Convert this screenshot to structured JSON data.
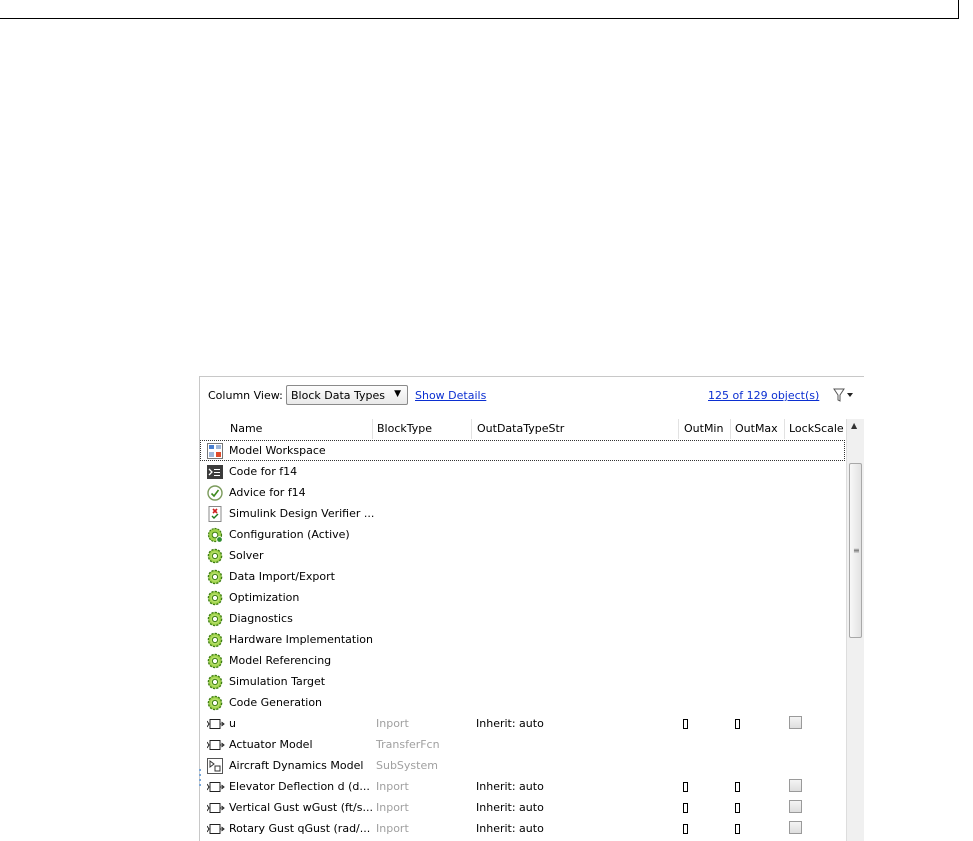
{
  "toolbar": {
    "column_view_label": "Column View:",
    "column_view_value": "Block Data Types",
    "show_details_label": "Show Details",
    "object_count": "125 of 129 object(s)"
  },
  "columns": {
    "name": "Name",
    "block_type": "BlockType",
    "out_data_type": "OutDataTypeStr",
    "out_min": "OutMin",
    "out_max": "OutMax",
    "lock_scale": "LockScale"
  },
  "rows": [
    {
      "icon": "model-workspace-icon",
      "name": "Model Workspace",
      "block_type": "",
      "out_data_type": ""
    },
    {
      "icon": "code-icon",
      "name": "Code for f14",
      "block_type": "",
      "out_data_type": ""
    },
    {
      "icon": "advice-check-icon",
      "name": "Advice for f14",
      "block_type": "",
      "out_data_type": ""
    },
    {
      "icon": "design-verifier-icon",
      "name": "Simulink Design Verifier ...",
      "block_type": "",
      "out_data_type": ""
    },
    {
      "icon": "configuration-active-icon",
      "name": "Configuration (Active)",
      "block_type": "",
      "out_data_type": ""
    },
    {
      "icon": "gear-icon",
      "name": "Solver",
      "block_type": "",
      "out_data_type": ""
    },
    {
      "icon": "gear-icon",
      "name": "Data Import/Export",
      "block_type": "",
      "out_data_type": ""
    },
    {
      "icon": "gear-icon",
      "name": "Optimization",
      "block_type": "",
      "out_data_type": ""
    },
    {
      "icon": "gear-icon",
      "name": "Diagnostics",
      "block_type": "",
      "out_data_type": ""
    },
    {
      "icon": "gear-icon",
      "name": "Hardware Implementation",
      "block_type": "",
      "out_data_type": ""
    },
    {
      "icon": "gear-icon",
      "name": "Model Referencing",
      "block_type": "",
      "out_data_type": ""
    },
    {
      "icon": "gear-icon",
      "name": "Simulation Target",
      "block_type": "",
      "out_data_type": ""
    },
    {
      "icon": "gear-icon",
      "name": "Code Generation",
      "block_type": "",
      "out_data_type": ""
    },
    {
      "icon": "block-port-icon",
      "name": "u",
      "block_type": "Inport",
      "out_data_type": "Inherit: auto"
    },
    {
      "icon": "block-port-icon",
      "name": "Actuator Model",
      "block_type": "TransferFcn",
      "out_data_type": ""
    },
    {
      "icon": "subsystem-icon",
      "name": "Aircraft Dynamics Model",
      "block_type": "SubSystem",
      "out_data_type": ""
    },
    {
      "icon": "block-port-icon",
      "name": "Elevator Deflection d (d...",
      "block_type": "Inport",
      "out_data_type": "Inherit: auto"
    },
    {
      "icon": "block-port-icon",
      "name": "Vertical Gust wGust (ft/s...",
      "block_type": "Inport",
      "out_data_type": "Inherit: auto"
    },
    {
      "icon": "block-port-icon",
      "name": "Rotary Gust qGust (rad/...",
      "block_type": "Inport",
      "out_data_type": "Inherit: auto"
    }
  ]
}
